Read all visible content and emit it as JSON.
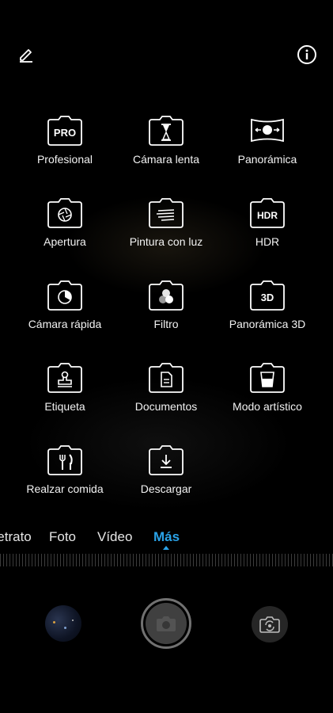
{
  "top_bar": {
    "edit_icon": "pencil-edit-icon",
    "info_icon": "info-circle-icon"
  },
  "modes": [
    {
      "id": "pro",
      "label": "Profesional",
      "icon": "camera-pro-icon",
      "icon_text": "PRO"
    },
    {
      "id": "slowmo",
      "label": "Cámara lenta",
      "icon": "camera-hourglass-icon"
    },
    {
      "id": "panorama",
      "label": "Panorámica",
      "icon": "camera-panorama-icon"
    },
    {
      "id": "aperture",
      "label": "Apertura",
      "icon": "camera-aperture-icon"
    },
    {
      "id": "lightpainting",
      "label": "Pintura con luz",
      "icon": "camera-light-trails-icon"
    },
    {
      "id": "hdr",
      "label": "HDR",
      "icon": "camera-hdr-icon",
      "icon_text": "HDR"
    },
    {
      "id": "quick",
      "label": "Cámara rápida",
      "icon": "camera-timelapse-icon"
    },
    {
      "id": "filter",
      "label": "Filtro",
      "icon": "camera-filter-icon"
    },
    {
      "id": "pano3d",
      "label": "Panorámica 3D",
      "icon": "camera-3d-icon",
      "icon_text": "3D"
    },
    {
      "id": "stamp",
      "label": "Etiqueta",
      "icon": "camera-stamp-icon"
    },
    {
      "id": "docs",
      "label": "Documentos",
      "icon": "camera-document-icon"
    },
    {
      "id": "artistic",
      "label": "Modo artístico",
      "icon": "camera-cup-icon"
    },
    {
      "id": "food",
      "label": "Realzar comida",
      "icon": "camera-fork-knife-icon"
    },
    {
      "id": "download",
      "label": "Descargar",
      "icon": "camera-download-icon"
    }
  ],
  "mode_bar": {
    "tabs": [
      "Retrato",
      "Foto",
      "Vídeo",
      "Más"
    ],
    "active": "Más"
  },
  "bottom_controls": {
    "gallery_icon": "gallery-thumbnail",
    "shutter_icon": "shutter-camera-icon",
    "switch_icon": "switch-camera-icon"
  },
  "colors": {
    "background": "#000000",
    "accent": "#2aa3e8",
    "text": "#f2f2f2"
  }
}
